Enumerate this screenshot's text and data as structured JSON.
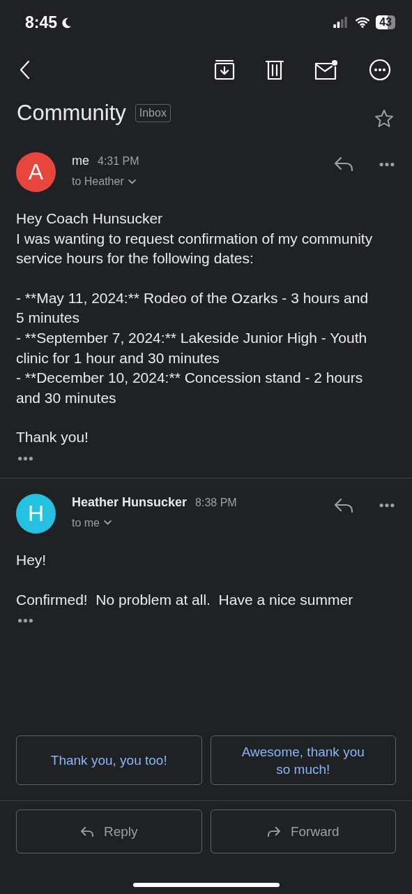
{
  "status_bar": {
    "time": "8:45",
    "battery": "43"
  },
  "subject": {
    "title": "Community",
    "label": "Inbox",
    "starred": false
  },
  "messages": [
    {
      "avatar_letter": "A",
      "color": "#e8453c",
      "sender": "me",
      "emphasized": false,
      "time": "4:31 PM",
      "recipient": "to Heather",
      "paragraphs": [
        "Hey Coach Hunsucker\nI was wanting to request confirmation of my community service hours for the following dates:",
        "- **May 11, 2024:** Rodeo of the Ozarks - 3 hours and 5 minutes\n- **September 7, 2024:** Lakeside Junior High - Youth clinic for 1 hour and 30 minutes\n- **December 10, 2024:** Concession stand - 2 hours and 30 minutes",
        "Thank you!"
      ]
    },
    {
      "avatar_letter": "H",
      "color": "#25c1e0",
      "sender": "Heather Hunsucker",
      "emphasized": true,
      "time": "8:38 PM",
      "recipient": "to me",
      "paragraphs": [
        "Hey!",
        "Confirmed!  No problem at all.  Have a nice summer"
      ]
    }
  ],
  "smart_replies": [
    "Thank you, you too!",
    "Awesome, thank you so much!"
  ],
  "actions": [
    {
      "kind": "reply",
      "label": "Reply"
    },
    {
      "kind": "forward",
      "label": "Forward"
    }
  ]
}
